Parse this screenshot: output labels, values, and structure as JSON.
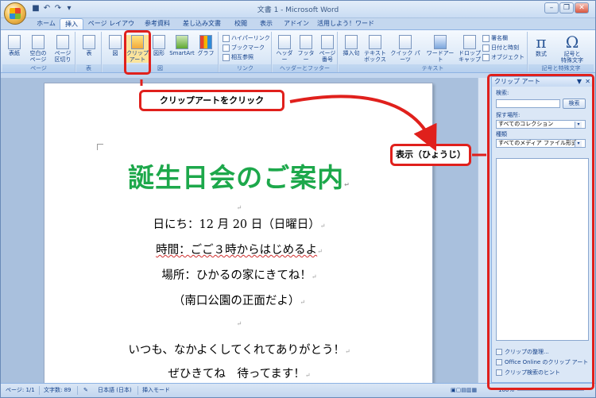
{
  "window": {
    "title": "文書 1 - Microsoft Word"
  },
  "tabs": [
    "ホーム",
    "挿入",
    "ページ レイアウト",
    "参考資料",
    "差し込み文書",
    "校閲",
    "表示",
    "アドイン",
    "活用しよう！ワード"
  ],
  "ribbon": {
    "pages": {
      "label": "ページ",
      "b1": "表紙",
      "b2": "空白の\nページ",
      "b3": "ページ\n区切り"
    },
    "table": {
      "label": "表",
      "b1": "表"
    },
    "illus": {
      "label": "図",
      "b1": "図",
      "b2": "クリップ\nアート",
      "b3": "図形",
      "b4": "SmartArt",
      "b5": "グラフ"
    },
    "links": {
      "label": "リンク",
      "b1": "ハイパーリンク",
      "b2": "ブックマーク",
      "b3": "相互参照"
    },
    "hf": {
      "label": "ヘッダーとフッター",
      "b1": "ヘッダー",
      "b2": "フッター",
      "b3": "ページ\n番号"
    },
    "text": {
      "label": "テキスト",
      "b1": "挿入句",
      "b2": "テキスト\nボックス",
      "b3": "クイック パーツ",
      "b4": "ワードアート",
      "b5": "ドロップ\nキャップ",
      "s1": "署名欄",
      "s2": "日付と時刻",
      "s3": "オブジェクト"
    },
    "sym": {
      "label": "記号と特殊文字",
      "b1": "数式",
      "b2": "記号と\n特殊文字"
    }
  },
  "document": {
    "title": "誕生日会のご案内",
    "lines": [
      "日にち：12 月 20 日（日曜日）",
      "時間：ごご３時からはじめるよ",
      "場所：ひかるの家にきてね！",
      "（南口公園の正面だよ）",
      "いつも、なかよくしてくれてありがとう！",
      "ぜひきてね　待ってます！"
    ],
    "para_mark": "↵"
  },
  "panel": {
    "title": "クリップ アート",
    "search_label": "検索:",
    "search_value": "",
    "search_button": "検索",
    "location_label": "探す場所:",
    "location_value": "すべてのコレクション",
    "type_label": "種類",
    "type_value": "すべてのメディア ファイル形式",
    "links": [
      "クリップの整理...",
      "Office Online のクリップ アート",
      "クリップ検索のヒント"
    ]
  },
  "status": {
    "page": "ページ: 1/1",
    "words": "文字数: 89",
    "lang": "日本語 (日本)",
    "mode": "挿入モード",
    "zoom": "100%"
  },
  "callouts": {
    "clipart": "クリップアートをクリック",
    "panel": "表示（ひょうじ）"
  },
  "colors": {
    "title_green": "#1da84b",
    "highlight_red": "#e0201c",
    "ribbon_blue": "#15428b"
  }
}
